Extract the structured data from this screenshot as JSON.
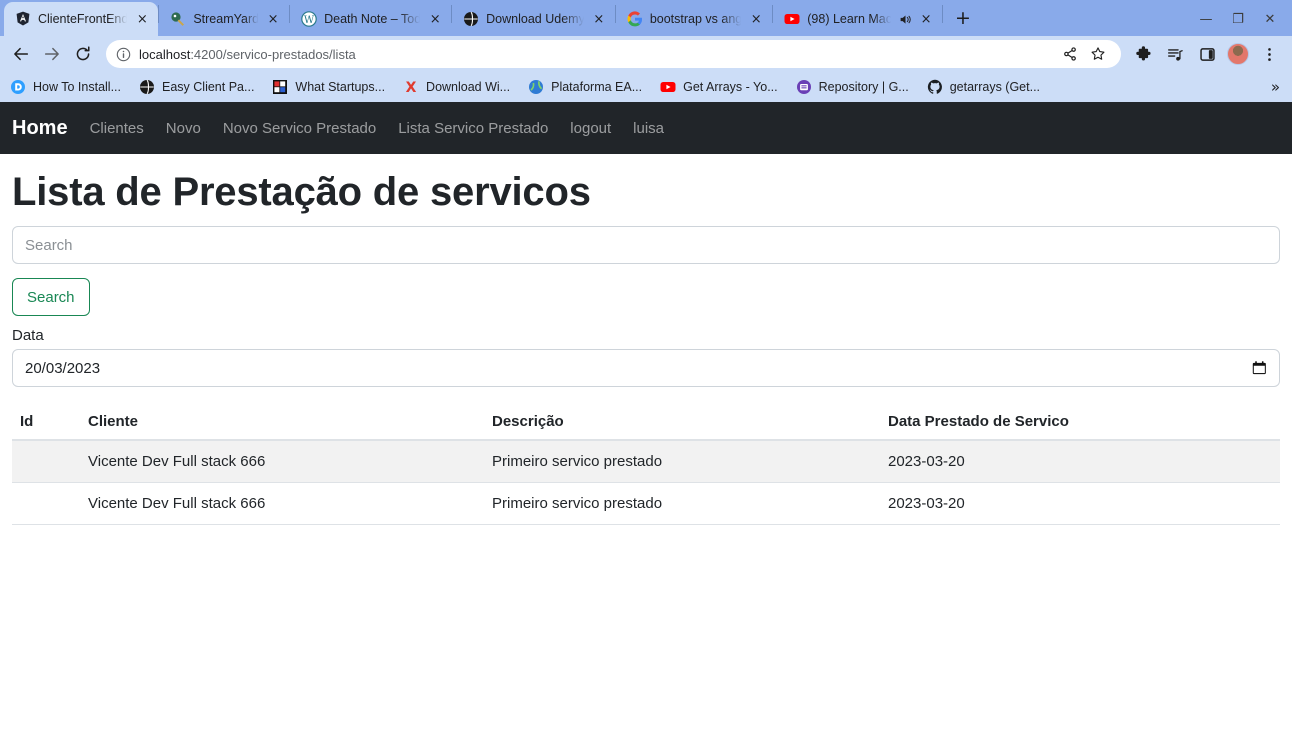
{
  "browser": {
    "tabs": [
      {
        "title": "ClienteFrontEnd",
        "favicon": "angular-icon",
        "active": true,
        "muted": false,
        "close_label": "×"
      },
      {
        "title": "StreamYard",
        "favicon": "streamyard-icon",
        "active": false,
        "muted": false,
        "close_label": "×"
      },
      {
        "title": "Death Note – Tod",
        "favicon": "wordpress-icon",
        "active": false,
        "muted": false,
        "close_label": "×"
      },
      {
        "title": "Download Udemy",
        "favicon": "globe-icon",
        "active": false,
        "muted": false,
        "close_label": "×"
      },
      {
        "title": "bootstrap vs ang",
        "favicon": "google-icon",
        "active": false,
        "muted": false,
        "close_label": "×"
      },
      {
        "title": "(98) Learn Mac",
        "favicon": "youtube-icon",
        "active": false,
        "muted": true,
        "close_label": "×"
      }
    ],
    "new_tab_label": "+",
    "window_controls": {
      "minimize": "—",
      "maximize": "❐",
      "close": "✕"
    },
    "nav": {
      "back": "back-arrow",
      "forward": "forward-arrow",
      "reload": "reload-arrow"
    },
    "omnibox": {
      "site_info_icon": "info-circle-icon",
      "url_host": "localhost",
      "url_path": ":4200/servico-prestados/lista",
      "share_icon": "share-icon",
      "bookmark_icon": "star-icon"
    },
    "toolbar_icons": [
      "extensions-icon",
      "reading-list-icon",
      "side-panel-icon",
      "profile-avatar",
      "more-menu-icon"
    ],
    "bookmarks": [
      {
        "label": "How To Install...",
        "favicon": "disqus-icon"
      },
      {
        "label": "Easy Client Pa...",
        "favicon": "globe-icon"
      },
      {
        "label": "What Startups...",
        "favicon": "redblue-square-icon"
      },
      {
        "label": "Download Wi...",
        "favicon": "x-red-icon"
      },
      {
        "label": "Plataforma EA...",
        "favicon": "blue-globe-icon"
      },
      {
        "label": "Get Arrays - Yo...",
        "favicon": "youtube-icon"
      },
      {
        "label": "Repository | G...",
        "favicon": "purple-circle-icon"
      },
      {
        "label": "getarrays (Get...",
        "favicon": "github-icon"
      }
    ],
    "bookmarks_overflow": "»"
  },
  "app": {
    "navbar": {
      "brand": "Home",
      "links": [
        "Clientes",
        "Novo",
        "Novo Servico Prestado",
        "Lista Servico Prestado",
        "logout",
        "luisa"
      ]
    },
    "page_title": "Lista de Prestação de servicos",
    "search": {
      "placeholder": "Search",
      "value": "",
      "button_label": "Search"
    },
    "date_field": {
      "label": "Data",
      "value": "20/03/2023",
      "picker_icon": "calendar-icon"
    },
    "table": {
      "columns": [
        "Id",
        "Cliente",
        "Descrição",
        "Data Prestado de Servico"
      ],
      "rows": [
        {
          "id": "",
          "cliente": "Vicente Dev Full stack 666",
          "descricao": "Primeiro servico prestado",
          "data": "2023-03-20"
        },
        {
          "id": "",
          "cliente": "Vicente Dev Full stack 666",
          "descricao": "Primeiro servico prestado",
          "data": "2023-03-20"
        }
      ]
    }
  },
  "colors": {
    "navbar_bg": "#212529",
    "accent_success": "#198754",
    "tabstrip_bg": "#89aaea",
    "toolbar_bg": "#ccddf7",
    "stripe_row": "#f2f2f2"
  }
}
